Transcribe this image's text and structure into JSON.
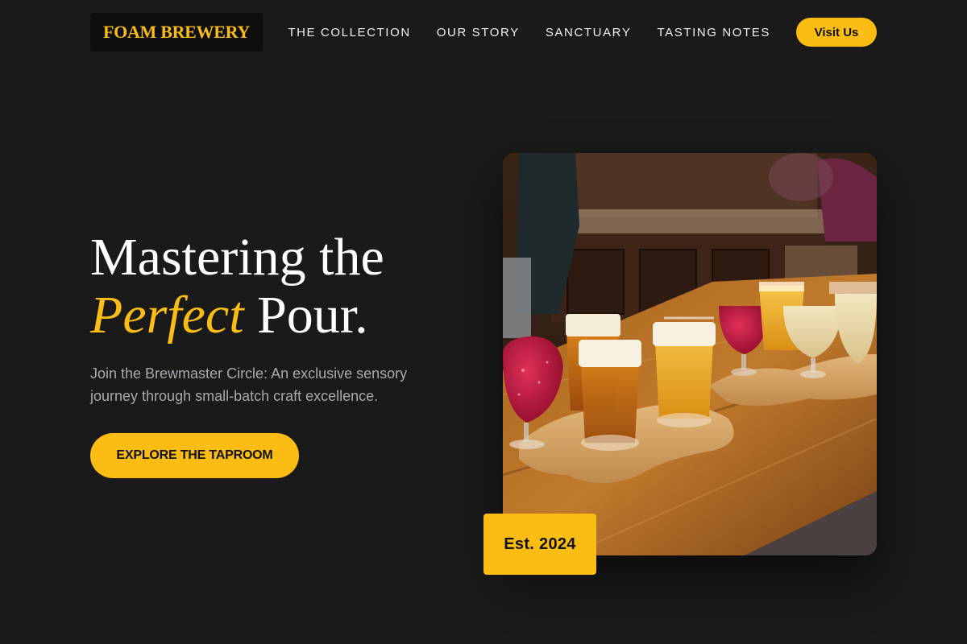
{
  "brand": {
    "name": "FOAM BREWERY",
    "accent_color": "#fbbd14",
    "background": "#1a1a1a"
  },
  "nav": {
    "links": [
      "THE COLLECTION",
      "OUR STORY",
      "SANCTUARY",
      "TASTING NOTES"
    ],
    "cta_label": "Visit Us"
  },
  "hero": {
    "title_line1": "Mastering the",
    "title_accent": "Perfect",
    "title_rest": "Pour.",
    "subtitle": "Join the Brewmaster Circle: An exclusive sensory journey through small-batch craft excellence.",
    "cta_label": "EXPLORE THE TAPROOM"
  },
  "image": {
    "subject": "beer-flight-tasting-paddles",
    "badge_text": "Est. 2024"
  }
}
